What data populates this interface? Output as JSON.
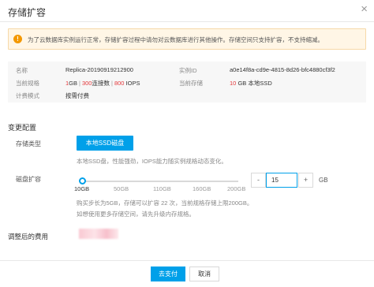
{
  "dialog": {
    "title": "存储扩容",
    "close_glyph": "×"
  },
  "notice": {
    "icon_glyph": "!",
    "text": "为了云数据库实例运行正常，存储扩容过程中请勿对云数据库进行其他操作。存储空间只支持扩容，不支持缩减。"
  },
  "info": {
    "name_label": "名称",
    "name_value": "Replica-20190919212900",
    "instance_label": "实例ID",
    "instance_value": "a0e14f8a-cd9e-4815-8d26-bfc4880cf3f2",
    "spec_label": "当前规格",
    "spec_parts": {
      "mem_num": "1",
      "mem_unit": "GB",
      "conn_num": "300",
      "conn_unit": "连接数",
      "iops_num": "800",
      "iops_unit": "IOPS",
      "sep": "|"
    },
    "storage_label": "当前存储",
    "storage_num": "10",
    "storage_unit": "GB",
    "storage_type": "本地SSD",
    "billing_label": "计费模式",
    "billing_value": "按需付费"
  },
  "change_config": {
    "section_title": "变更配置",
    "storage_type_label": "存储类型",
    "storage_type_button": "本地SSD磁盘",
    "storage_type_desc": "本地SSD盘，性能强劲，IOPS能力随实例规格动态变化。",
    "disk_label": "磁盘扩容",
    "slider": {
      "min": 10,
      "max": 200,
      "value": 10,
      "ticks": [
        "10GB",
        "50GB",
        "110GB",
        "160GB",
        "200GB"
      ]
    },
    "stepper": {
      "minus_glyph": "-",
      "plus_glyph": "+",
      "value": "15",
      "unit": "GB"
    },
    "hint_line1": "购买步长为5GB，存储可以扩容 22 次，当前规格存储上限200GB。",
    "hint_line2": "如想使用更多存储空间，请先升级内存规格。"
  },
  "fee": {
    "label": "调整后的费用"
  },
  "footer": {
    "pay_label": "去支付",
    "cancel_label": "取消"
  },
  "colors": {
    "accent": "#00a0e9",
    "warning": "#f39800",
    "highlight_red": "#e4393c"
  }
}
